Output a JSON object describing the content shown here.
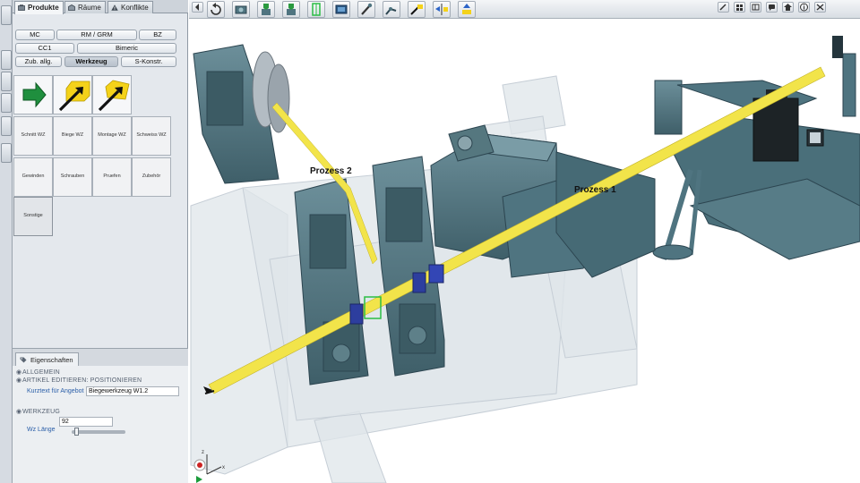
{
  "tabs": [
    {
      "label": "Produkte",
      "active": true,
      "icon": "products-icon"
    },
    {
      "label": "Räume",
      "active": false,
      "icon": "rooms-icon"
    },
    {
      "label": "Konflikte",
      "active": false,
      "icon": "warning-icon"
    }
  ],
  "filters": {
    "row1": [
      "MC",
      "RM / GRM",
      "BZ"
    ],
    "row2": [
      "CC1",
      "Bimeric"
    ],
    "row3": [
      "Zub. allg.",
      "Werkzeug",
      "S-Konstr."
    ],
    "active": "Werkzeug"
  },
  "tiles": {
    "icon_tiles": [
      {
        "icon": "green-arrow-icon"
      },
      {
        "icon": "tool-arrow-icon"
      },
      {
        "icon": "tool-arrow-icon"
      }
    ],
    "labels": [
      "Schnitt WZ",
      "Biege WZ",
      "Montage WZ",
      "Schweiss WZ",
      "Gewinden",
      "Schrauben",
      "Pruefen",
      "Zubehör",
      "Sonstige"
    ]
  },
  "properties": {
    "tab_label": "Eigenschaften",
    "section_general": "ALLGEMEIN",
    "section_edit": "ARTIKEL EDITIEREN: POSITIONIEREN",
    "kurztext_label": "Kurztext für Angebot",
    "kurztext_value": "Biegewerkzeug W1.2",
    "section_tool": "WERKZEUG",
    "wz_label": "Wz Länge",
    "wz_value": "92",
    "wz_slider_fraction": 0.05
  },
  "scene": {
    "label_process_2": "Prozess 2",
    "label_process_1": "Prozess 1",
    "machine_color": "#4f7480",
    "strip_color": "#f2e44a",
    "glass_color": "#d7dee4"
  },
  "toolbar": {
    "icons": [
      "collapse-icon",
      "undo-icon",
      "camera-view-icon",
      "view-front-icon",
      "view-side-icon",
      "green-frame-icon",
      "screen-icon",
      "plug-icon",
      "arm-icon",
      "tool-icon",
      "align-icon",
      "lift-icon"
    ],
    "window_icons": [
      "wrench-icon",
      "grid-icon",
      "panel-icon",
      "chat-icon",
      "home-icon",
      "info-icon",
      "close-icon"
    ]
  }
}
